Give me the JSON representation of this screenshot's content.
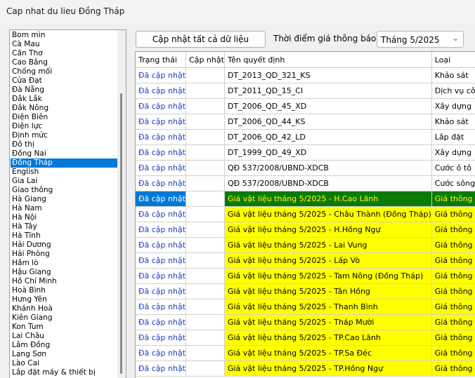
{
  "window": {
    "title": "Cap nhat du lieu Đồng Tháp"
  },
  "sidebar": {
    "selected": "Đồng Tháp",
    "items": [
      "Bom mìn",
      "Cà Mau",
      "Cần Thơ",
      "Cao Bằng",
      "Chống mối",
      "Cửa Đạt",
      "Đà Nẵng",
      "Đắk Lắk",
      "Đắk Nông",
      "Điện Biên",
      "Điện lực",
      "Định mức",
      "Đô thị",
      "Đồng Nai",
      "Đồng Tháp",
      "English",
      "Gia Lai",
      "Giao thông",
      "Hà Giang",
      "Hà Nam",
      "Hà Nội",
      "Hà Tây",
      "Hà Tĩnh",
      "Hải Dương",
      "Hải Phòng",
      "Hầm lò",
      "Hậu Giang",
      "Hồ Chí Minh",
      "Hoà Bình",
      "Hưng Yên",
      "Khánh Hoà",
      "Kiên Giang",
      "Kon Tum",
      "Lai Châu",
      "Lâm Đồng",
      "Lạng Sơn",
      "Lào Cai",
      "Lắp đặt máy & thiết bị"
    ]
  },
  "toolbar": {
    "update_all_label": "Cập nhật tất cả dữ liệu",
    "date_label": "Thời điểm giá thông báo",
    "month_value": "Tháng 5/2025"
  },
  "grid": {
    "columns": [
      "Trạng thái",
      "Cập nhật",
      "Tên quyết định",
      "Loại"
    ],
    "rows": [
      {
        "status": "Đã cập nhật",
        "update": "",
        "name": "DT_2013_QD_321_KS",
        "type": "Khảo sát",
        "style": ""
      },
      {
        "status": "Đã cập nhật",
        "update": "",
        "name": "DT_2011_QD_15_CI",
        "type": "Dịch vụ công ích",
        "style": ""
      },
      {
        "status": "Đã cập nhật",
        "update": "",
        "name": "DT_2006_QD_45_XD",
        "type": "Xây dựng",
        "style": ""
      },
      {
        "status": "Đã cập nhật",
        "update": "",
        "name": "DT_2006_QD_44_KS",
        "type": "Khảo sát",
        "style": ""
      },
      {
        "status": "Đã cập nhật",
        "update": "",
        "name": "DT_2006_QD_42_LD",
        "type": "Lắp đặt",
        "style": ""
      },
      {
        "status": "Đã cập nhật",
        "update": "",
        "name": "DT_1999_QD_49_XD",
        "type": "Xây dựng",
        "style": ""
      },
      {
        "status": "Đã cập nhật",
        "update": "",
        "name": "QĐ 537/2008/UBND-XDCB",
        "type": "Cước ô tô",
        "style": ""
      },
      {
        "status": "Đã cập nhật",
        "update": "",
        "name": "QĐ 537/2008/UBND-XDCB",
        "type": "Cước sông",
        "style": ""
      },
      {
        "status": "Đã cập nhật",
        "update": "",
        "name": "Giá vật liệu tháng 5/2025 - H.Cao Lãnh",
        "type": "Giá thông báo",
        "style": "sel"
      },
      {
        "status": "Đã cập nhật",
        "update": "",
        "name": "Giá vật liệu tháng 5/2025 - Châu Thành (Đồng Tháp)",
        "type": "Giá thông báo",
        "style": "yellow"
      },
      {
        "status": "Đã cập nhật",
        "update": "",
        "name": "Giá vật liệu tháng 5/2025 - H.Hồng Ngự",
        "type": "Giá thông báo",
        "style": "yellow"
      },
      {
        "status": "Đã cập nhật",
        "update": "",
        "name": "Giá vật liệu tháng 5/2025 - Lai Vung",
        "type": "Giá thông báo",
        "style": "yellow"
      },
      {
        "status": "Đã cập nhật",
        "update": "",
        "name": "Giá vật liệu tháng 5/2025 - Lấp Vò",
        "type": "Giá thông báo",
        "style": "yellow"
      },
      {
        "status": "Đã cập nhật",
        "update": "",
        "name": "Giá vật liệu tháng 5/2025 - Tam Nông (Đồng Tháp)",
        "type": "Giá thông báo",
        "style": "yellow"
      },
      {
        "status": "Đã cập nhật",
        "update": "",
        "name": "Giá vật liệu tháng 5/2025 - Tân Hồng",
        "type": "Giá thông báo",
        "style": "yellow"
      },
      {
        "status": "Đã cập nhật",
        "update": "",
        "name": "Giá vật liệu tháng 5/2025 - Thanh Bình",
        "type": "Giá thông báo",
        "style": "yellow"
      },
      {
        "status": "Đã cập nhật",
        "update": "",
        "name": "Giá vật liệu tháng 5/2025 - Tháp Mười",
        "type": "Giá thông báo",
        "style": "yellow"
      },
      {
        "status": "Đã cập nhật",
        "update": "",
        "name": "Giá vật liệu tháng 5/2025 - TP.Cao Lãnh",
        "type": "Giá thông báo",
        "style": "yellow"
      },
      {
        "status": "Đã cập nhật",
        "update": "",
        "name": "Giá vật liệu tháng 5/2025 - TP.Sa Đéc",
        "type": "Giá thông báo",
        "style": "yellow"
      },
      {
        "status": "Đã cập nhật",
        "update": "",
        "name": "Giá vật liệu tháng 5/2025 - TP.Hồng Ngự",
        "type": "Giá thông báo",
        "style": "yellow"
      }
    ]
  }
}
